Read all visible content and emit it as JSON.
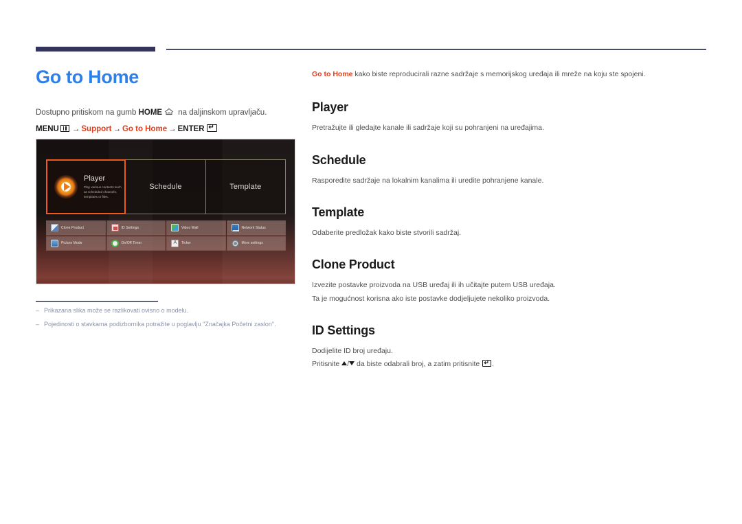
{
  "page": {
    "title": "Go to Home",
    "title_color": "#2f7fe9",
    "accent_color": "#e03c1a",
    "header_bar_color": "#32345c"
  },
  "left": {
    "access_prefix": "Dostupno pritiskom na gumb ",
    "access_key": "HOME",
    "access_suffix": " na daljinskom upravljaču.",
    "menu_path": {
      "menu_label": "MENU",
      "arrow": "→",
      "step1": "Support",
      "step2": "Go to Home",
      "enter_label": "ENTER"
    },
    "notes": [
      {
        "dash": "–",
        "text": "Prikazana slika može se razlikovati ovisno o modelu."
      },
      {
        "dash": "–",
        "text": "Pojedinosti o stavkama podizbornika potražite u poglavlju \"Značajka Početni zaslon\"."
      }
    ]
  },
  "tv": {
    "main_tiles": [
      {
        "label": "Player",
        "desc": "Play various contents such as scheduled channels, templates or files.",
        "selected": true,
        "icon": "play-circle-icon"
      },
      {
        "label": "Schedule",
        "desc": "",
        "selected": false,
        "icon": ""
      },
      {
        "label": "Template",
        "desc": "",
        "selected": false,
        "icon": ""
      }
    ],
    "sub_tiles": [
      {
        "label": "Clone Product",
        "icon": "clone-product-icon"
      },
      {
        "label": "ID Settings",
        "icon": "id-settings-icon"
      },
      {
        "label": "Video Wall",
        "icon": "video-wall-icon"
      },
      {
        "label": "Network Status",
        "icon": "network-status-icon"
      },
      {
        "label": "Picture Mode",
        "icon": "picture-mode-icon"
      },
      {
        "label": "On/Off Timer",
        "icon": "on-off-timer-icon"
      },
      {
        "label": "Ticker",
        "icon": "ticker-icon"
      },
      {
        "label": "More settings",
        "icon": "more-settings-icon"
      }
    ]
  },
  "right": {
    "intro_accent": "Go to Home",
    "intro_rest": " kako biste reproducirali razne sadržaje s memorijskog uređaja ili mreže na koju ste spojeni.",
    "sections": [
      {
        "heading": "Player",
        "paragraphs": [
          "Pretražujte ili gledajte kanale ili sadržaje koji su pohranjeni na uređajima."
        ]
      },
      {
        "heading": "Schedule",
        "paragraphs": [
          "Rasporedite sadržaje na lokalnim kanalima ili uredite pohranjene kanale."
        ]
      },
      {
        "heading": "Template",
        "paragraphs": [
          "Odaberite predložak kako biste stvorili sadržaj."
        ]
      },
      {
        "heading": "Clone Product",
        "paragraphs": [
          "Izvezite postavke proizvoda na USB uređaj ili ih učitajte putem USB uređaja.",
          "Ta je mogućnost korisna ako iste postavke dodjeljujete nekoliko proizvoda."
        ]
      },
      {
        "heading": "ID Settings",
        "paragraphs": [
          "Dodijelite ID broj uređaju."
        ],
        "press_line": {
          "prefix": "Pritisnite ",
          "separator": "/",
          "middle": " da biste odabrali broj, a zatim pritisnite ",
          "suffix": "."
        }
      }
    ]
  }
}
